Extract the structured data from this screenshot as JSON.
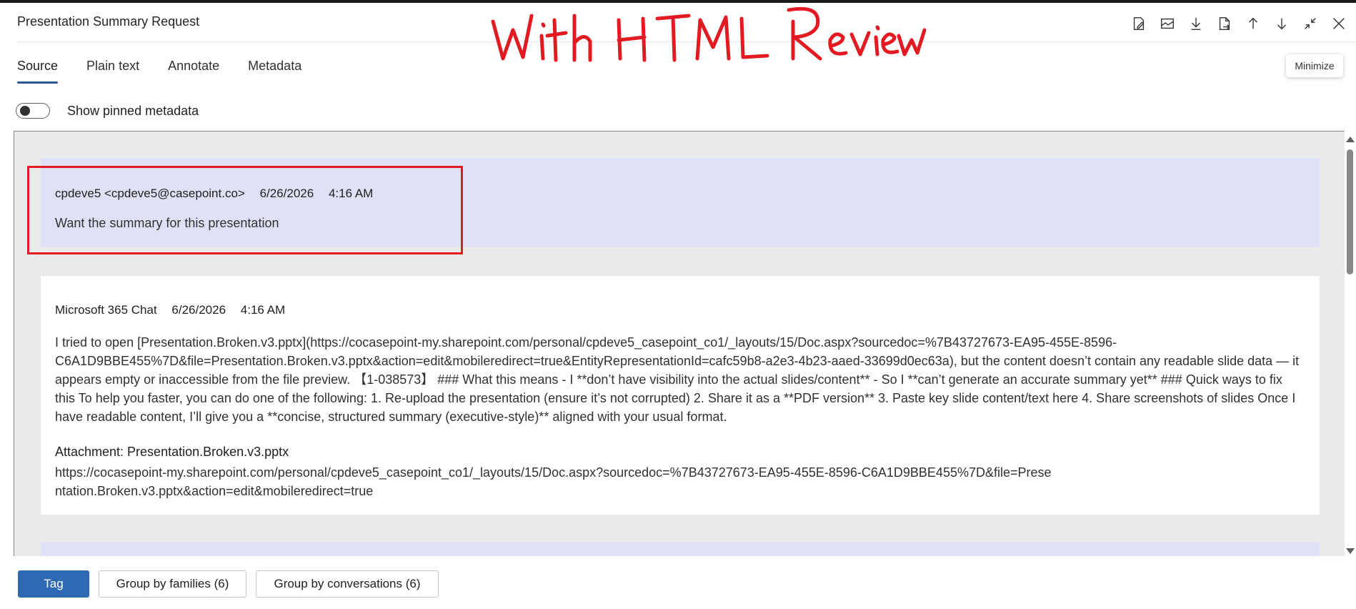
{
  "window": {
    "title": "Presentation Summary Request"
  },
  "annotation": {
    "handwritten_text": "With HTML Review",
    "color": "#e21b23"
  },
  "toolbar": {
    "icons": [
      "edit-note-icon",
      "email-icon",
      "download-icon",
      "export-file-icon",
      "arrow-up-icon",
      "arrow-down-icon",
      "minimize-icon",
      "close-icon"
    ],
    "tooltip": "Minimize"
  },
  "tabs": [
    {
      "label": "Source",
      "active": true
    },
    {
      "label": "Plain text",
      "active": false
    },
    {
      "label": "Annotate",
      "active": false
    },
    {
      "label": "Metadata",
      "active": false
    }
  ],
  "pinned_metadata": {
    "label": "Show pinned metadata",
    "on": false
  },
  "messages": [
    {
      "sender": "cpdeve5 <cpdeve5@casepoint.co>",
      "date": "6/26/2026",
      "time": "4:16 AM",
      "text": "Want the summary for this presentation"
    },
    {
      "sender": "Microsoft 365 Chat",
      "date": "6/26/2026",
      "time": "4:16 AM",
      "text": "I tried to open [Presentation.Broken.v3.pptx](https://cocasepoint-my.sharepoint.com/personal/cpdeve5_casepoint_co1/_layouts/15/Doc.aspx?sourcedoc=%7B43727673-EA95-455E-8596-C6A1D9BBE455%7D&file=Presentation.Broken.v3.pptx&action=edit&mobileredirect=true&EntityRepresentationId=cafc59b8-a2e3-4b23-aaed-33699d0ec63a), but the content doesn’t contain any readable slide data — it appears empty or inaccessible from the file preview. 【1-038573】 ### What this means - I **don’t have visibility into the actual slides/content** - So I **can’t generate an accurate summary yet** ### Quick ways to fix this To help you faster, you can do one of the following: 1. Re-upload the presentation (ensure it’s not corrupted) 2. Share it as a **PDF version** 3. Paste key slide content/text here 4. Share screenshots of slides Once I have readable content, I’ll give you a **concise, structured summary (executive-style)** aligned with your usual format.",
      "attachment_label": "Attachment: Presentation.Broken.v3.pptx",
      "attachment_url": "https://cocasepoint-my.sharepoint.com/personal/cpdeve5_casepoint_co1/_layouts/15/Doc.aspx?sourcedoc=%7B43727673-EA95-455E-8596-C6A1D9BBE455%7D&file=Presentation.Broken.v3.pptx&action=edit&mobileredirect=true"
    }
  ],
  "footer": {
    "tag_label": "Tag",
    "group_families_label": "Group by families (6)",
    "group_conversations_label": "Group by conversations (6)"
  },
  "colors": {
    "accent": "#2e6ab4",
    "user_bubble": "#dfe1f6",
    "highlight": "#e21b23"
  }
}
